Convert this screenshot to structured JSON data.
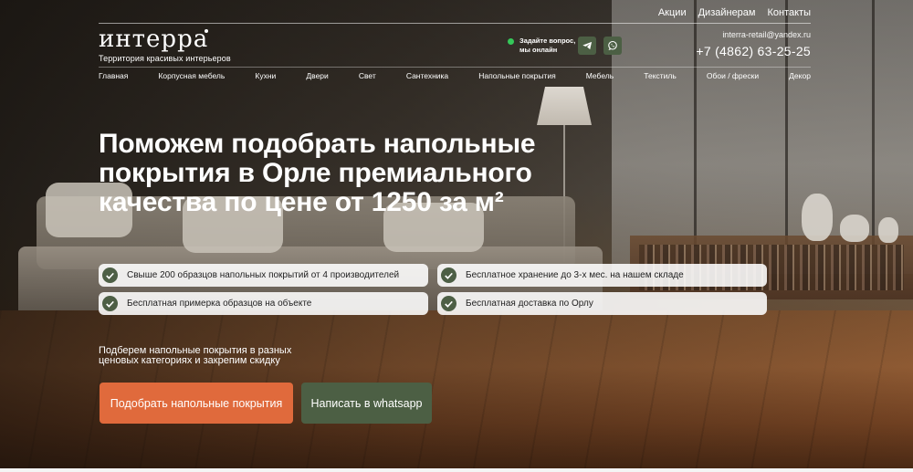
{
  "header": {
    "top_links": [
      "Акции",
      "Дизайнерам",
      "Контакты"
    ],
    "logo_text": "интерра",
    "tagline": "Территория красивых интерьеров",
    "online_line1": "Задайте вопрос,",
    "online_line2": "мы онлайн",
    "email": "interra-retail@yandex.ru",
    "phone": "+7 (4862) 63-25-25"
  },
  "nav": {
    "items": [
      "Главная",
      "Корпусная мебель",
      "Кухни",
      "Двери",
      "Свет",
      "Сантехника",
      "Напольные покрытия",
      "Мебель",
      "Текстиль",
      "Обои / фрески",
      "Декор"
    ]
  },
  "hero": {
    "title": "Поможем подобрать напольные покрытия в Орле премиального качества по цене от 1250 за м²",
    "features": [
      "Свыше 200 образцов напольных покрытий от 4 производителей",
      "Бесплатное хранение до 3-х мес. на нашем складе",
      "Бесплатная примерка образцов на объекте",
      "Бесплатная доставка по Орлу"
    ],
    "subtitle": "Подберем напольные покрытия в разных ценовых категориях и закрепим скидку",
    "cta_primary": "Подобрать напольные покрытия",
    "cta_secondary": "Написать в whatsapp"
  },
  "colors": {
    "accent_orange": "#e06a3c",
    "accent_green": "#4c5f44",
    "online_green": "#35c759"
  },
  "icons": [
    "telegram-icon",
    "whatsapp-icon",
    "check-icon"
  ]
}
